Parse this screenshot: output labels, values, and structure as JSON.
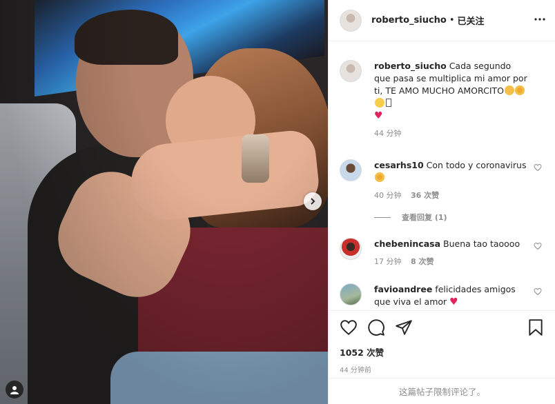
{
  "post": {
    "username": "roberto_siucho",
    "dot": "•",
    "follow_status": "已关注",
    "caption": "Cada segundo que pasa se multiplica mi amor por ti, TE AMO MUCHO AMORCITO",
    "caption_time": "44 分钟",
    "likes": "1052 次赞",
    "posted_time": "44 分钟前",
    "comments_restricted": "这篇帖子限制评论了。"
  },
  "comments": [
    {
      "user": "cesarhs10",
      "text": "Con todo y coronavirus",
      "time": "40 分钟",
      "likes": "36 次赞",
      "replies": "查看回复 (1)"
    },
    {
      "user": "chebenincasa",
      "text": "Buena tao taoooo",
      "time": "17 分钟",
      "likes": "8 次赞"
    },
    {
      "user": "favioandree",
      "text": "felicidades amigos que viva el amor"
    }
  ],
  "icons": {
    "more": "more-options-icon",
    "like": "heart-icon",
    "comment": "comment-icon",
    "share": "share-icon",
    "save": "bookmark-icon",
    "next": "chevron-right-icon"
  },
  "colors": {
    "red_heart": "#e0245e",
    "meta_gray": "#8e8e8e"
  }
}
